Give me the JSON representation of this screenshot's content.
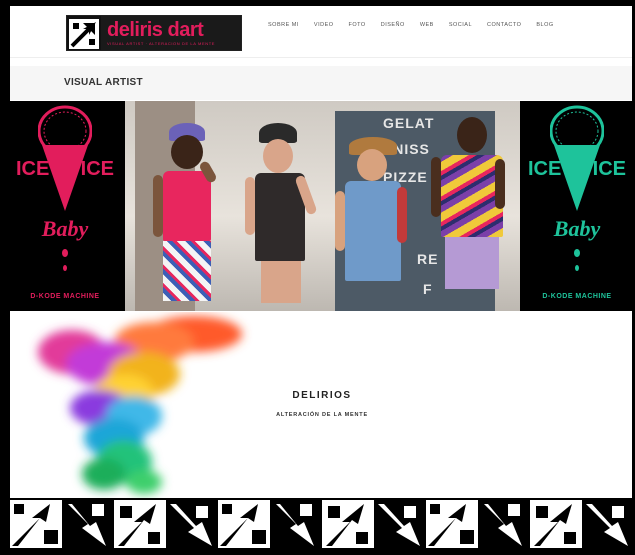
{
  "header": {
    "logo_text": "deliris dart",
    "logo_tagline": "VISUAL ARTIST · ALTERACION DE LA MENTE",
    "nav": [
      "SOBRE MI",
      "VIDEO",
      "FOTO",
      "DISEÑO",
      "WEB",
      "SOCIAL",
      "CONTACTO",
      "BLOG"
    ]
  },
  "subtitle": "VISUAL ARTIST",
  "hero": {
    "poster_left": {
      "ice1": "ICE",
      "ice2": "ICE",
      "baby": "Baby",
      "machine": "D-KODE MACHINE"
    },
    "poster_right": {
      "ice1": "ICE",
      "ice2": "ICE",
      "baby": "Baby",
      "machine": "D-KODE MACHINE"
    },
    "shop_words": [
      "GELAT",
      "RANISS",
      "PIZZE",
      "RE",
      "F"
    ]
  },
  "section": {
    "title": "DELIRIOS",
    "subtitle": "ALTERACIÓN DE LA MENTE"
  },
  "colors": {
    "brand_pink": "#e21d5c",
    "teal": "#1ec39b",
    "black": "#000000"
  }
}
